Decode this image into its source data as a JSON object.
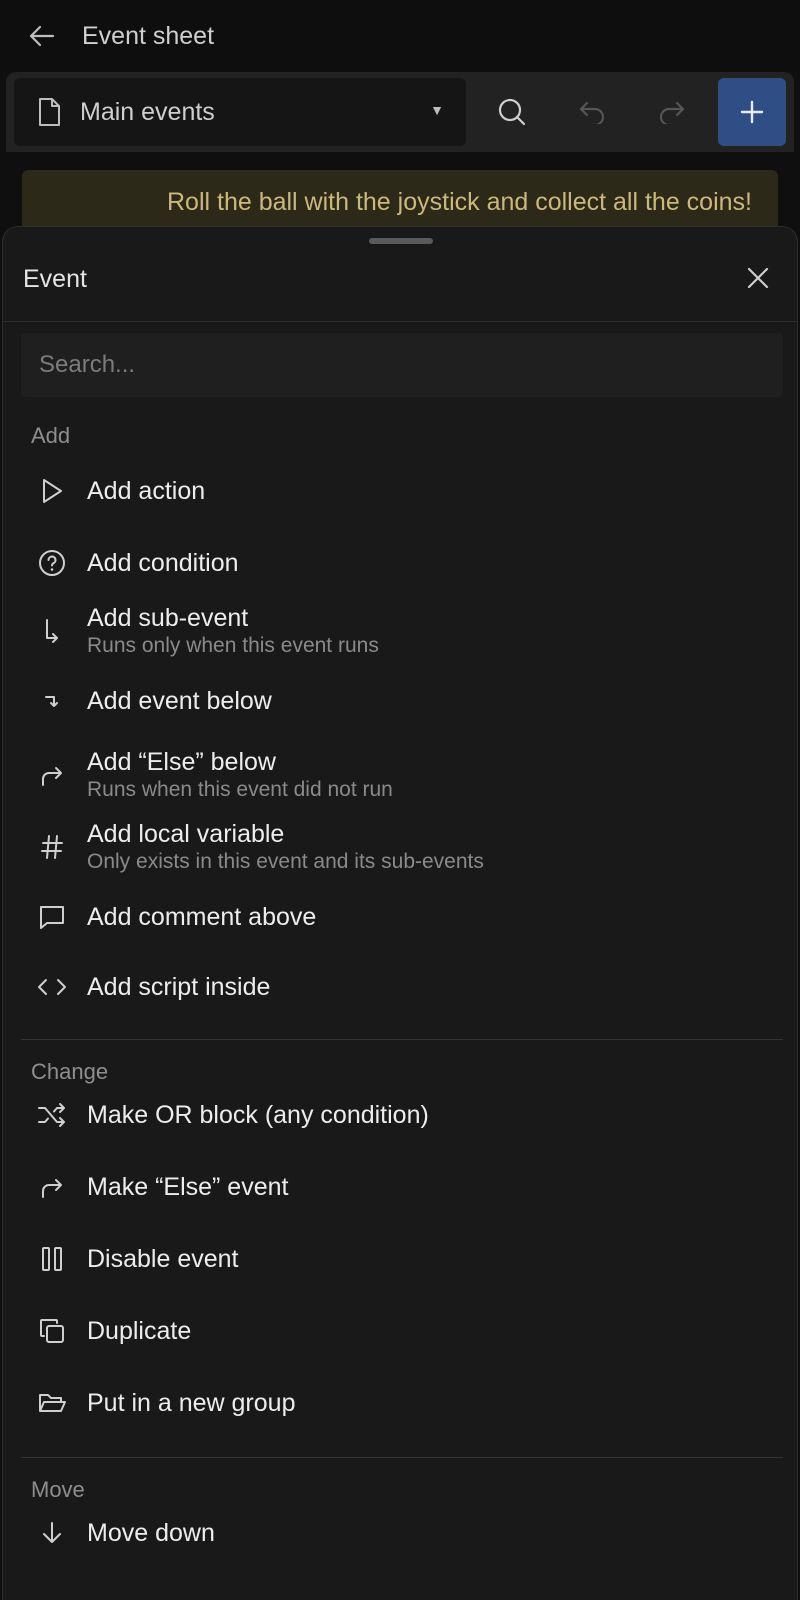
{
  "header": {
    "title": "Event sheet"
  },
  "toolbar": {
    "sheet_name": "Main events"
  },
  "banner": {
    "text": "Roll the ball with the joystick and collect all the coins!"
  },
  "panel": {
    "title": "Event",
    "search_placeholder": "Search...",
    "sections": {
      "add": "Add",
      "change": "Change",
      "move": "Move"
    },
    "add_items": [
      {
        "label": "Add action",
        "icon": "play-icon"
      },
      {
        "label": "Add condition",
        "icon": "question-circle-icon"
      },
      {
        "label": "Add sub-event",
        "sub": "Runs only when this event runs",
        "icon": "subdirectory-arrow-icon"
      },
      {
        "label": "Add event below",
        "icon": "arrow-down-right-icon"
      },
      {
        "label": "Add “Else” below",
        "sub": "Runs when this event did not run",
        "icon": "forward-arrow-icon"
      },
      {
        "label": "Add local variable",
        "sub": "Only exists in this event and its sub-events",
        "icon": "hash-icon"
      },
      {
        "label": "Add comment above",
        "icon": "comment-icon"
      },
      {
        "label": "Add script inside",
        "icon": "code-icon"
      }
    ],
    "change_items": [
      {
        "label": "Make OR block (any condition)",
        "icon": "shuffle-icon"
      },
      {
        "label": "Make “Else” event",
        "icon": "forward-arrow-icon"
      },
      {
        "label": "Disable event",
        "icon": "pause-icon"
      },
      {
        "label": "Duplicate",
        "icon": "copy-icon"
      },
      {
        "label": "Put in a new group",
        "icon": "folder-open-icon"
      }
    ],
    "move_items": [
      {
        "label": "Move down",
        "icon": "arrow-down-icon"
      }
    ]
  },
  "colors": {
    "background": "#0f0f0f",
    "panel": "#191919",
    "accent_button": "#2f4e86",
    "banner_bg": "#2c2918",
    "banner_text": "#cbb87a"
  }
}
